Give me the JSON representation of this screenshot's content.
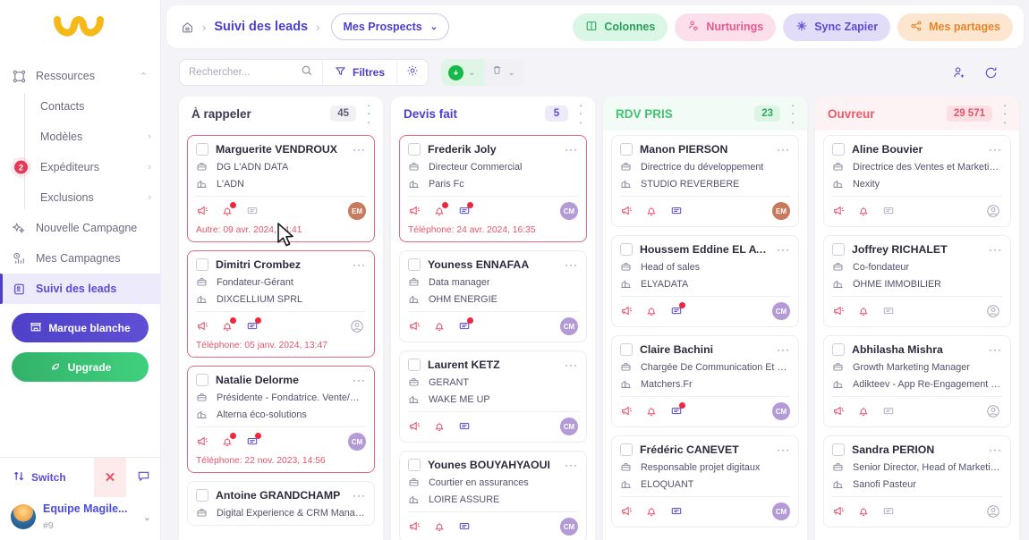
{
  "sidebar": {
    "logo_name": "magileads-logo",
    "nav": [
      {
        "label": "Ressources",
        "icon": "resources-icon",
        "chevron": "⌃",
        "active": false,
        "expanded": true
      }
    ],
    "subnav": [
      {
        "label": "Contacts",
        "chevron": "",
        "badge": ""
      },
      {
        "label": "Modèles",
        "chevron": "›",
        "badge": ""
      },
      {
        "label": "Expéditeurs",
        "chevron": "›",
        "badge": "2"
      },
      {
        "label": "Exclusions",
        "chevron": "›",
        "badge": ""
      }
    ],
    "nav2": [
      {
        "label": "Nouvelle Campagne",
        "icon": "sparkle-icon",
        "active": false
      },
      {
        "label": "Mes Campagnes",
        "icon": "chart-clock-icon",
        "active": false
      },
      {
        "label": "Suivi des leads",
        "icon": "contact-card-icon",
        "active": true
      }
    ],
    "buttons": {
      "white_label": "Marque blanche",
      "upgrade": "Upgrade"
    },
    "footer": {
      "switch_label": "Switch",
      "team_name": "Equipe Magile...",
      "team_id": "#9"
    }
  },
  "topbar": {
    "breadcrumb_home_icon": "home-icon",
    "breadcrumb_separator": "›",
    "breadcrumb_title": "Suivi des leads",
    "selected_view": "Mes Prospects",
    "chips": [
      {
        "label": "Colonnes",
        "icon": "columns-icon",
        "style": "chip-green"
      },
      {
        "label": "Nurturings",
        "icon": "nurturing-icon",
        "style": "chip-pink"
      },
      {
        "label": "Sync Zapier",
        "icon": "zapier-icon",
        "style": "chip-purple"
      },
      {
        "label": "Mes partages",
        "icon": "share-icon",
        "style": "chip-orange"
      }
    ]
  },
  "toolbar": {
    "search_placeholder": "Rechercher...",
    "search_value": "",
    "search_icon": "search-icon",
    "filters_label": "Filtres",
    "filters_icon": "filter-icon",
    "settings_icon": "gear-icon",
    "download_icon": "download-icon",
    "delete_icon": "trash-icon",
    "dropdown_caret": "⌄",
    "add_user_icon": "add-user-icon",
    "refresh_icon": "refresh-icon"
  },
  "board": {
    "columns": [
      {
        "title": "À rappeler",
        "count": "45",
        "title_color": "#3a3a52",
        "count_bg": "#f0f0f5",
        "count_color": "#5c5c74",
        "head_bg": "#ffffff",
        "menu_color": "#3bbd6b",
        "cards": [
          {
            "name": "Marguerite VENDROUX",
            "role": "DG L'ADN DATA",
            "company": "L'ADN",
            "date": "Autre: 09 avr. 2024, 14:41",
            "highlight": true,
            "avatar": "EM",
            "avatar_style": "em",
            "badges": {
              "megaphone": false,
              "bell": true,
              "comment": false
            },
            "comment_muted": true
          },
          {
            "name": "Dimitri Crombez",
            "role": "Fondateur-Gérant",
            "company": "DIXCELLIUM SPRL",
            "date": "Téléphone: 05 janv. 2024, 13:47",
            "highlight": true,
            "avatar": "",
            "avatar_style": "none",
            "badges": {
              "megaphone": false,
              "bell": true,
              "comment": true
            },
            "comment_muted": false
          },
          {
            "name": "Natalie Delorme",
            "role": "Présidente - Fondatrice. Vente/Marke...",
            "company": "Alterna éco-solutions",
            "date": "Téléphone: 22 nov. 2023, 14:56",
            "highlight": true,
            "avatar": "CM",
            "avatar_style": "cm",
            "badges": {
              "megaphone": false,
              "bell": true,
              "comment": true
            },
            "comment_muted": false
          },
          {
            "name": "Antoine GRANDCHAMP",
            "role": "Digital Experience & CRM Manager",
            "company": "",
            "date": "",
            "highlight": false,
            "avatar": "",
            "avatar_style": "none",
            "badges": {
              "megaphone": false,
              "bell": false,
              "comment": false
            },
            "comment_muted": true
          }
        ]
      },
      {
        "title": "Devis fait",
        "count": "5",
        "title_color": "#4b3fd0",
        "count_bg": "#eceafb",
        "count_color": "#5b4bd6",
        "head_bg": "#ffffff",
        "menu_color": "#3bbd6b",
        "cards": [
          {
            "name": "Frederik Joly",
            "role": "Directeur Commercial",
            "company": "Paris Fc",
            "date": "Téléphone: 24 avr. 2024, 16:35",
            "highlight": true,
            "avatar": "CM",
            "avatar_style": "cm",
            "badges": {
              "megaphone": false,
              "bell": true,
              "comment": true
            },
            "comment_muted": false
          },
          {
            "name": "Youness ENNAFAA",
            "role": "Data manager",
            "company": "OHM ENERGIE",
            "date": "",
            "highlight": false,
            "avatar": "CM",
            "avatar_style": "cm",
            "badges": {
              "megaphone": false,
              "bell": false,
              "comment": true
            },
            "comment_muted": false
          },
          {
            "name": "Laurent KETZ",
            "role": "GERANT",
            "company": "WAKE ME UP",
            "date": "",
            "highlight": false,
            "avatar": "CM",
            "avatar_style": "cm",
            "badges": {
              "megaphone": false,
              "bell": false,
              "comment": false
            },
            "comment_muted": false
          },
          {
            "name": "Younes BOUYAHYAOUI",
            "role": "Courtier en assurances",
            "company": "LOIRE ASSURE",
            "date": "",
            "highlight": false,
            "avatar": "CM",
            "avatar_style": "cm",
            "badges": {
              "megaphone": false,
              "bell": false,
              "comment": false
            },
            "comment_muted": false
          }
        ]
      },
      {
        "title": "RDV PRIS",
        "count": "23",
        "title_color": "#3fc46f",
        "count_bg": "#dcf5e5",
        "count_color": "#35a95f",
        "head_bg": "#f2fbf5",
        "menu_color": "#3bbd6b",
        "cards": [
          {
            "name": "Manon PIERSON",
            "role": "Directrice du développement",
            "company": "STUDIO REVERBERE",
            "date": "",
            "highlight": false,
            "avatar": "EM",
            "avatar_style": "em",
            "badges": {
              "megaphone": false,
              "bell": false,
              "comment": false
            },
            "comment_muted": false
          },
          {
            "name": "Houssem Eddine EL AYADI",
            "role": "Head of sales",
            "company": "ELYADATA",
            "date": "",
            "highlight": false,
            "avatar": "CM",
            "avatar_style": "cm",
            "badges": {
              "megaphone": false,
              "bell": false,
              "comment": true
            },
            "comment_muted": false
          },
          {
            "name": "Claire Bachini",
            "role": "Chargée De Communication Et Rédact...",
            "company": "Matchers.Fr",
            "date": "",
            "highlight": false,
            "avatar": "CM",
            "avatar_style": "cm",
            "badges": {
              "megaphone": false,
              "bell": false,
              "comment": true
            },
            "comment_muted": false
          },
          {
            "name": "Frédéric CANEVET",
            "role": "Responsable projet digitaux",
            "company": "ELOQUANT",
            "date": "",
            "highlight": false,
            "avatar": "CM",
            "avatar_style": "cm",
            "badges": {
              "megaphone": false,
              "bell": false,
              "comment": false
            },
            "comment_muted": false
          }
        ]
      },
      {
        "title": "Ouvreur",
        "count": "29 571",
        "title_color": "#ef5a6a",
        "count_bg": "#fcdfe2",
        "count_color": "#e2576a",
        "head_bg": "#fdf3f4",
        "menu_color": "#3bbd6b",
        "cards": [
          {
            "name": "Aline Bouvier",
            "role": "Directrice des Ventes et Marketing ré...",
            "company": "Nexity",
            "date": "",
            "highlight": false,
            "avatar": "",
            "avatar_style": "none",
            "badges": {
              "megaphone": false,
              "bell": false,
              "comment": false
            },
            "comment_muted": true
          },
          {
            "name": "Joffrey RICHALET",
            "role": "Co-fondateur",
            "company": "ÔHME IMMOBILIER",
            "date": "",
            "highlight": false,
            "avatar": "",
            "avatar_style": "none",
            "badges": {
              "megaphone": false,
              "bell": false,
              "comment": false
            },
            "comment_muted": true
          },
          {
            "name": "Abhilasha Mishra",
            "role": "Growth Marketing Manager",
            "company": "Adikteev - App Re-Engagement Platfor...",
            "date": "",
            "highlight": false,
            "avatar": "",
            "avatar_style": "none",
            "badges": {
              "megaphone": false,
              "bell": false,
              "comment": false
            },
            "comment_muted": true
          },
          {
            "name": "Sandra PERION",
            "role": "Senior Director, Head of Marketing, Fl...",
            "company": "Sanofi Pasteur",
            "date": "",
            "highlight": false,
            "avatar": "",
            "avatar_style": "none",
            "badges": {
              "megaphone": false,
              "bell": false,
              "comment": false
            },
            "comment_muted": true
          }
        ]
      }
    ]
  },
  "colors": {
    "accent_purple": "#5b4bd6",
    "accent_green": "#33b26a",
    "accent_red": "#e2576a",
    "accent_orange": "#e98428",
    "logo_yellow": "#f5b919"
  }
}
